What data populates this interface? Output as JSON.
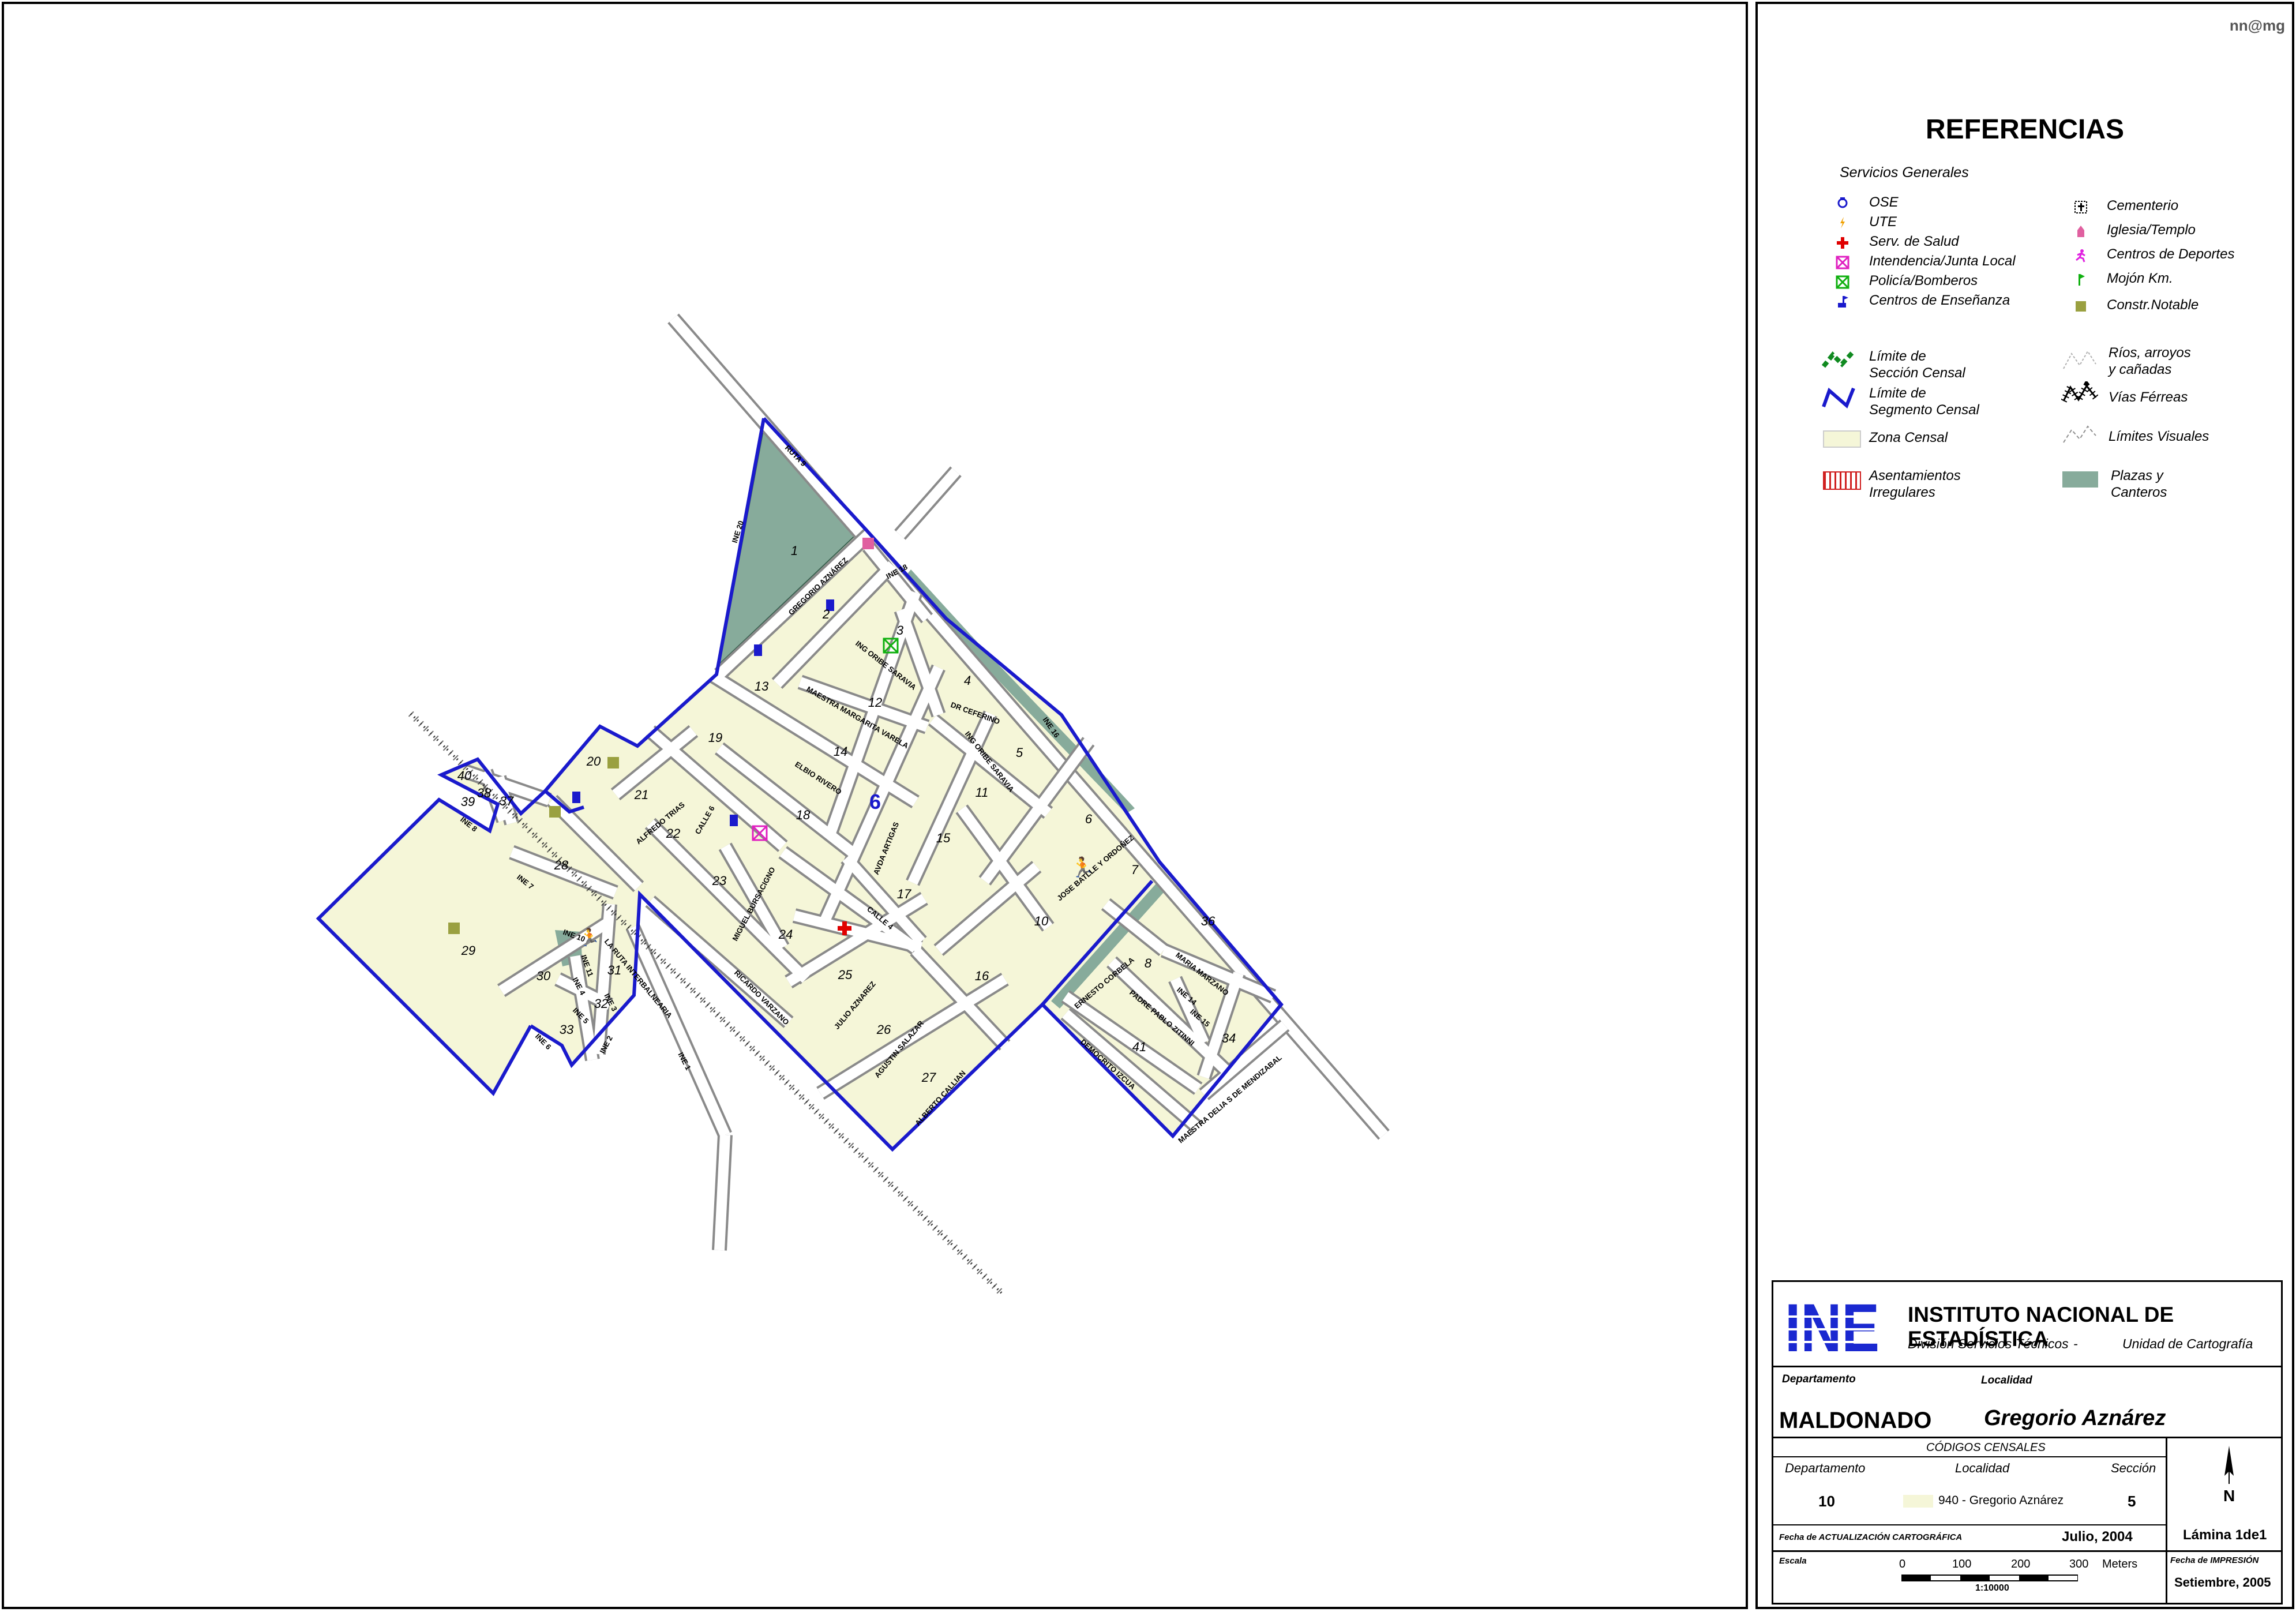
{
  "author_tag": "nn@mg",
  "legend": {
    "title": "REFERENCIAS",
    "section_title": "Servicios Generales",
    "left_items": [
      {
        "label": "OSE",
        "icon": "tap-icon",
        "color": "#1a1acc"
      },
      {
        "label": "UTE",
        "icon": "lightning-icon",
        "color": "#f0a000"
      },
      {
        "label": "Serv. de Salud",
        "icon": "red-cross-icon",
        "color": "#e00000"
      },
      {
        "label": "Intendencia/Junta Local",
        "icon": "boxed-x-magenta-icon",
        "color": "#e020c0"
      },
      {
        "label": "Policía/Bomberos",
        "icon": "boxed-x-green-icon",
        "color": "#10b010"
      },
      {
        "label": "Centros de Enseñanza",
        "icon": "school-flag-icon",
        "color": "#1a1acc"
      }
    ],
    "right_items": [
      {
        "label": "Cementerio",
        "icon": "cross-box-icon",
        "color": "#000000"
      },
      {
        "label": "Iglesia/Templo",
        "icon": "church-icon",
        "color": "#e060a0"
      },
      {
        "label": "Centros de Deportes",
        "icon": "runner-icon",
        "color": "#e020e0"
      },
      {
        "label": "Mojón Km.",
        "icon": "flag-marker-icon",
        "color": "#10b010"
      },
      {
        "label": "Constr.Notable",
        "icon": "square-olive-icon",
        "color": "#9aa040"
      }
    ],
    "lines": {
      "seccion": "Límite de\nSección Censal",
      "segmento": "Límite de\nSegmento Censal",
      "zona": "Zona Censal",
      "asentamientos": "Asentamientos\nIrregulares",
      "rios": "Ríos, arroyos\ny cañadas",
      "vias": "Vías Férreas",
      "limites": "Límites  Visuales",
      "plazas": "Plazas y\nCanteros"
    }
  },
  "institution": {
    "logo": "INE",
    "name": "INSTITUTO NACIONAL DE ESTADÍSTICA",
    "division": "División Servicios Técnicos",
    "separator": "-",
    "unit": "Unidad de Cartografía"
  },
  "location": {
    "departamento_label": "Departamento",
    "departamento": "MALDONADO",
    "localidad_label": "Localidad",
    "localidad": "Gregorio Aznárez"
  },
  "codes": {
    "title": "CÓDIGOS CENSALES",
    "dep_label": "Departamento",
    "dep_value": "10",
    "loc_label": "Localidad",
    "loc_value": "940 - Gregorio Aznárez",
    "sec_label": "Sección",
    "sec_value": "5",
    "sheet": "Lámina 1de1",
    "north": "N"
  },
  "dates": {
    "update_label": "Fecha de ACTUALIZACIÓN CARTOGRÁFICA",
    "update_value": "Julio, 2004",
    "print_label": "Fecha de IMPRESIÓN",
    "print_value": "Setiembre, 2005"
  },
  "scale": {
    "label": "Escala",
    "ticks": [
      "0",
      "100",
      "200",
      "300"
    ],
    "unit": "Meters",
    "ratio": "1:10000"
  },
  "colors": {
    "zone": "#f5f6d8",
    "plaza": "#87ab9b",
    "segment": "#1a1acc",
    "road": "#707070"
  },
  "map": {
    "section_number": "6",
    "segments": [
      "1",
      "2",
      "3",
      "4",
      "5",
      "6",
      "7",
      "8",
      "10",
      "11",
      "12",
      "13",
      "14",
      "15",
      "16",
      "17",
      "18",
      "19",
      "20",
      "21",
      "22",
      "23",
      "24",
      "25",
      "26",
      "27",
      "28",
      "29",
      "30",
      "31",
      "32",
      "33",
      "34",
      "36",
      "37",
      "38",
      "39",
      "40",
      "41"
    ],
    "streets": [
      "RUTA 9",
      "INE 20",
      "GREGORIO AZNÁREZ",
      "INE 18",
      "ING ORIBE SARAVIA",
      "MAESTRA MARGARITA VARELA",
      "DR CEFERINO",
      "ING ORIBE SARAVIA",
      "INE 16",
      "ELBIO RIVERO",
      "AVDA ARTIGAS",
      "ALFREDO TRIAS",
      "CALLE 6",
      "MIGUEL BURSACIGNO",
      "RICARDO VARZANO",
      "CALLE 4",
      "JULIO AZNAREZ",
      "AGUSTIN SALAZAR",
      "ALBERTO CALLIAN",
      "JOSE BATLLE Y ORDOÑEZ",
      "ERNESTO CORBELA",
      "MARIA MARZANO",
      "PADRE PABLO ZITINNI",
      "INE 14",
      "INE 15",
      "DEMOCRITO IZCUA",
      "MAESTRA DELIA S DE MENDIZABAL",
      "INE 7",
      "INE 8",
      "LA RUTA INTERBALNEARIA",
      "INE 1",
      "INE 2",
      "INE 3",
      "INE 4",
      "INE 5",
      "INE 6",
      "INE 10",
      "INE 11"
    ]
  }
}
